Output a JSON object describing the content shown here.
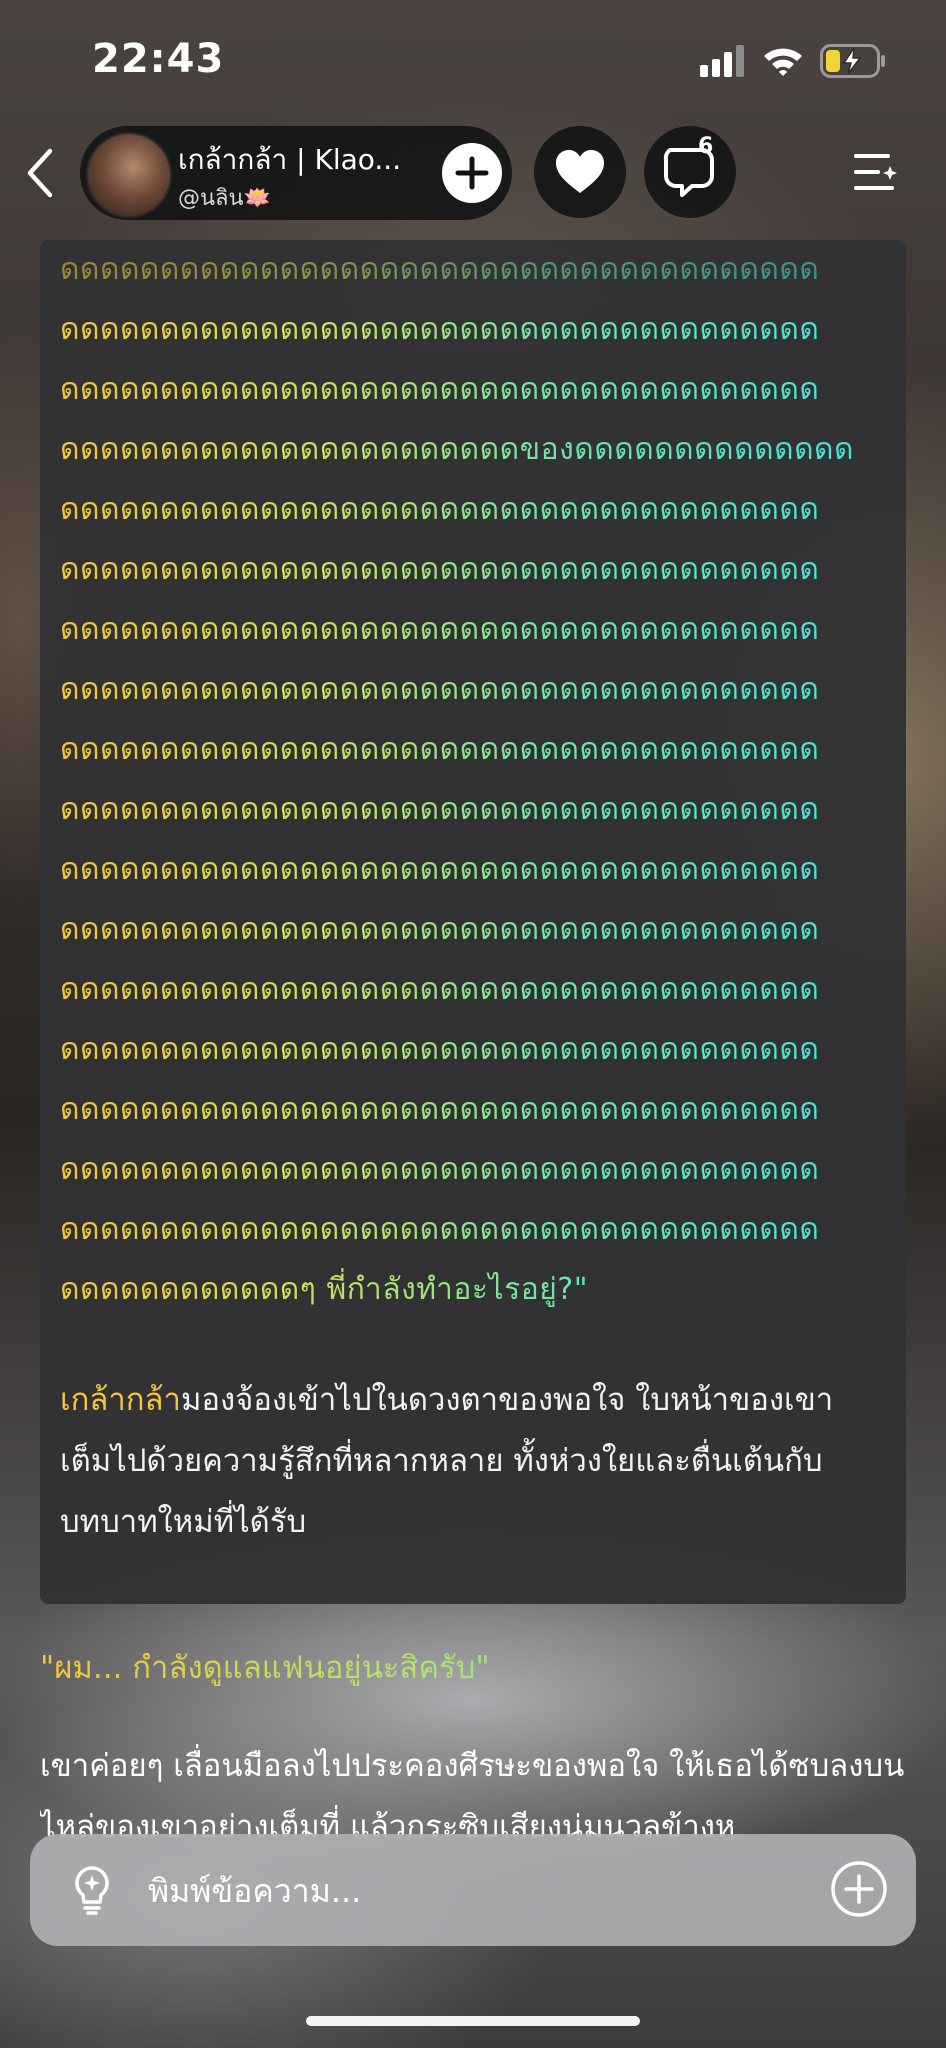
{
  "status_bar": {
    "time": "22:43",
    "icons": [
      "cellular-signal-icon",
      "wifi-icon",
      "battery-charging-icon"
    ],
    "battery_color": "#f3d33a"
  },
  "header": {
    "back_icon": "chevron-left-icon",
    "profile_name": "เกล้ากล้า | Klao...",
    "profile_handle": "@นลิน🪷",
    "follow_icon": "plus-icon",
    "like_icon": "heart-icon",
    "comment_icon": "comment-bubble-icon",
    "comment_count": "6",
    "menu_icon": "chapter-list-icon"
  },
  "story": {
    "dd_lines": [
      "ดดดดดดดดดดดดดดดดดดดดดดดดดดดดดดดดดดดดดด",
      "ดดดดดดดดดดดดดดดดดดดดดดดดดดดดดดดดดดดดดด",
      "ดดดดดดดดดดดดดดดดดดดดดดดดดดดดดดดดดดดดดด",
      "ดดดดดดดดดดดดดดดดดดดดดดดของดดดดดดดดดดดดดด",
      "ดดดดดดดดดดดดดดดดดดดดดดดดดดดดดดดดดดดดดด",
      "ดดดดดดดดดดดดดดดดดดดดดดดดดดดดดดดดดดดดดด",
      "ดดดดดดดดดดดดดดดดดดดดดดดดดดดดดดดดดดดดดด",
      "ดดดดดดดดดดดดดดดดดดดดดดดดดดดดดดดดดดดดดด",
      "ดดดดดดดดดดดดดดดดดดดดดดดดดดดดดดดดดดดดดด",
      "ดดดดดดดดดดดดดดดดดดดดดดดดดดดดดดดดดดดดดด",
      "ดดดดดดดดดดดดดดดดดดดดดดดดดดดดดดดดดดดดดด",
      "ดดดดดดดดดดดดดดดดดดดดดดดดดดดดดดดดดดดดดด",
      "ดดดดดดดดดดดดดดดดดดดดดดดดดดดดดดดดดดดดดด",
      "ดดดดดดดดดดดดดดดดดดดดดดดดดดดดดดดดดดดดดด",
      "ดดดดดดดดดดดดดดดดดดดดดดดดดดดดดดดดดดดดดด",
      "ดดดดดดดดดดดดดดดดดดดดดดดดดดดดดดดดดดดดดด",
      "ดดดดดดดดดดดดดดดดดดดดดดดดดดดดดดดดดดดดดด",
      "ดดดดดดดดดดดดๆ พี่กำลังทำอะไรอยู่?\""
    ],
    "narration_name": "เกล้ากล้า",
    "narration_text": "มองจ้องเข้าไปในดวงตาของพอใจ ใบหน้าของเขาเต็มไปด้วยความรู้สึกที่หลากหลาย ทั้งห่วงใยและตื่นเต้นกับบทบาทใหม่ที่ได้รับ"
  },
  "dialogue": "\"ผม... กำลังดูแลแฟนอยู่นะสิครับ\"",
  "body_text": "เขาค่อยๆ เลื่อนมือลงไปประคองศีรษะของพอใจ ให้เธอได้ซบลงบนไหล่ของเขาอย่างเต็มที่ แล้วกระซิบเสียงนุ่มนวลข้างหู",
  "message_bar": {
    "hint_icon": "lightbulb-icon",
    "placeholder": "พิมพ์ข้อความ...",
    "add_icon": "plus-circle-icon"
  }
}
